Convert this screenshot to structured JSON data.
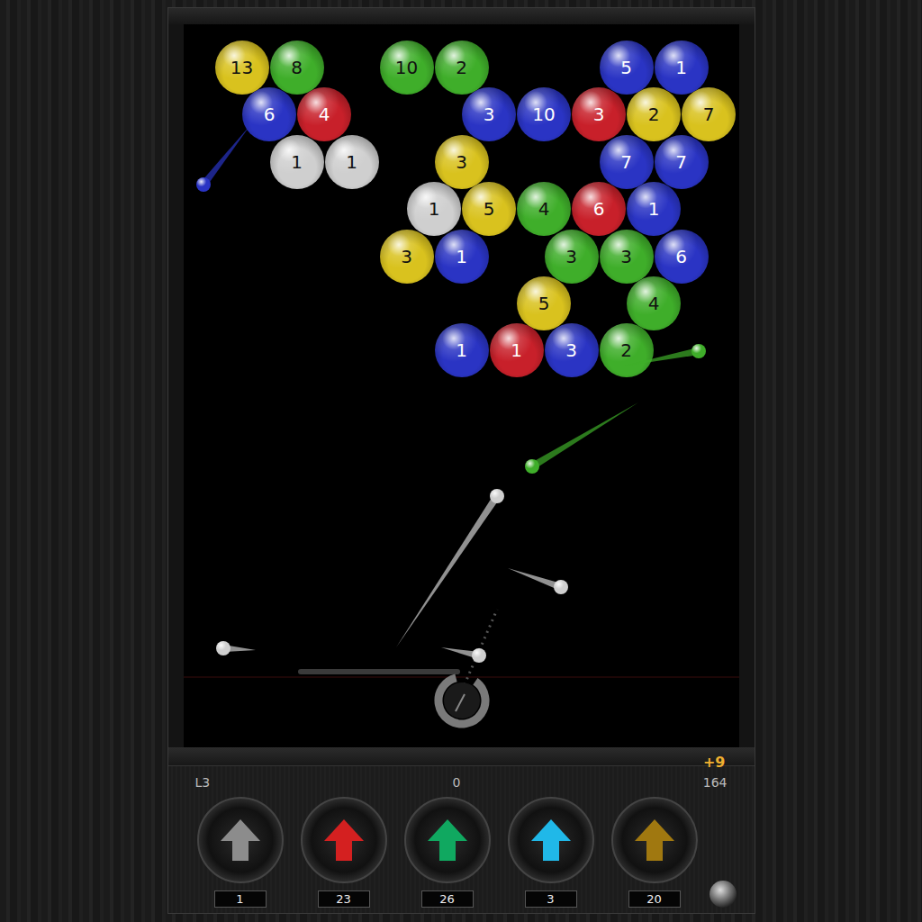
{
  "hud": {
    "level": "L3",
    "score": "0",
    "remaining": "164",
    "bonus": "+9"
  },
  "bubbles": [
    {
      "row": 0,
      "col": 0,
      "number": "13",
      "color": "#d9c21e"
    },
    {
      "row": 0,
      "col": 1,
      "number": "8",
      "color": "#3fae2a"
    },
    {
      "row": 0,
      "col": 3,
      "number": "10",
      "color": "#3fae2a"
    },
    {
      "row": 0,
      "col": 4,
      "number": "2",
      "color": "#3fae2a"
    },
    {
      "row": 0,
      "col": 7,
      "number": "5",
      "color": "#2a34c4"
    },
    {
      "row": 0,
      "col": 8,
      "number": "1",
      "color": "#2a34c4"
    },
    {
      "row": 1,
      "col": 0,
      "number": "6",
      "color": "#2a34c4"
    },
    {
      "row": 1,
      "col": 1,
      "number": "4",
      "color": "#c8202a"
    },
    {
      "row": 1,
      "col": 4,
      "number": "3",
      "color": "#2a34c4"
    },
    {
      "row": 1,
      "col": 5,
      "number": "10",
      "color": "#2a34c4"
    },
    {
      "row": 1,
      "col": 6,
      "number": "3",
      "color": "#c8202a"
    },
    {
      "row": 1,
      "col": 7,
      "number": "2",
      "color": "#d9c21e"
    },
    {
      "row": 1,
      "col": 8,
      "number": "7",
      "color": "#d9c21e"
    },
    {
      "row": 2,
      "col": 1,
      "number": "1",
      "color": "#cfcfcf"
    },
    {
      "row": 2,
      "col": 2,
      "number": "1",
      "color": "#cfcfcf"
    },
    {
      "row": 2,
      "col": 4,
      "number": "3",
      "color": "#d9c21e"
    },
    {
      "row": 2,
      "col": 7,
      "number": "7",
      "color": "#2a34c4"
    },
    {
      "row": 2,
      "col": 8,
      "number": "7",
      "color": "#2a34c4"
    },
    {
      "row": 3,
      "col": 3,
      "number": "1",
      "color": "#cfcfcf"
    },
    {
      "row": 3,
      "col": 4,
      "number": "5",
      "color": "#d9c21e"
    },
    {
      "row": 3,
      "col": 5,
      "number": "4",
      "color": "#3fae2a"
    },
    {
      "row": 3,
      "col": 6,
      "number": "6",
      "color": "#c8202a"
    },
    {
      "row": 3,
      "col": 7,
      "number": "1",
      "color": "#2a34c4"
    },
    {
      "row": 4,
      "col": 3,
      "number": "3",
      "color": "#d9c21e"
    },
    {
      "row": 4,
      "col": 4,
      "number": "1",
      "color": "#2a34c4"
    },
    {
      "row": 4,
      "col": 6,
      "number": "3",
      "color": "#3fae2a"
    },
    {
      "row": 4,
      "col": 7,
      "number": "3",
      "color": "#3fae2a"
    },
    {
      "row": 4,
      "col": 8,
      "number": "6",
      "color": "#2a34c4"
    },
    {
      "row": 5,
      "col": 5,
      "number": "5",
      "color": "#d9c21e"
    },
    {
      "row": 5,
      "col": 7,
      "number": "4",
      "color": "#3fae2a"
    },
    {
      "row": 6,
      "col": 4,
      "number": "1",
      "color": "#2a34c4"
    },
    {
      "row": 6,
      "col": 5,
      "number": "1",
      "color": "#c8202a"
    },
    {
      "row": 6,
      "col": 6,
      "number": "3",
      "color": "#2a34c4"
    },
    {
      "row": 6,
      "col": 7,
      "number": "2",
      "color": "#3fae2a"
    }
  ],
  "flying": [
    {
      "color": "#2a34c4"
    },
    {
      "color": "#3fae2a"
    },
    {
      "color": "#3fae2a"
    },
    {
      "color": "#cfcfcf"
    },
    {
      "color": "#cfcfcf"
    },
    {
      "color": "#cfcfcf"
    },
    {
      "color": "#cfcfcf"
    }
  ],
  "powerups": [
    {
      "count": "1",
      "color": "#8c8c8c"
    },
    {
      "count": "23",
      "color": "#d42020"
    },
    {
      "count": "26",
      "color": "#10a860"
    },
    {
      "count": "3",
      "color": "#20b8e8"
    },
    {
      "count": "20",
      "color": "#a07810"
    }
  ]
}
